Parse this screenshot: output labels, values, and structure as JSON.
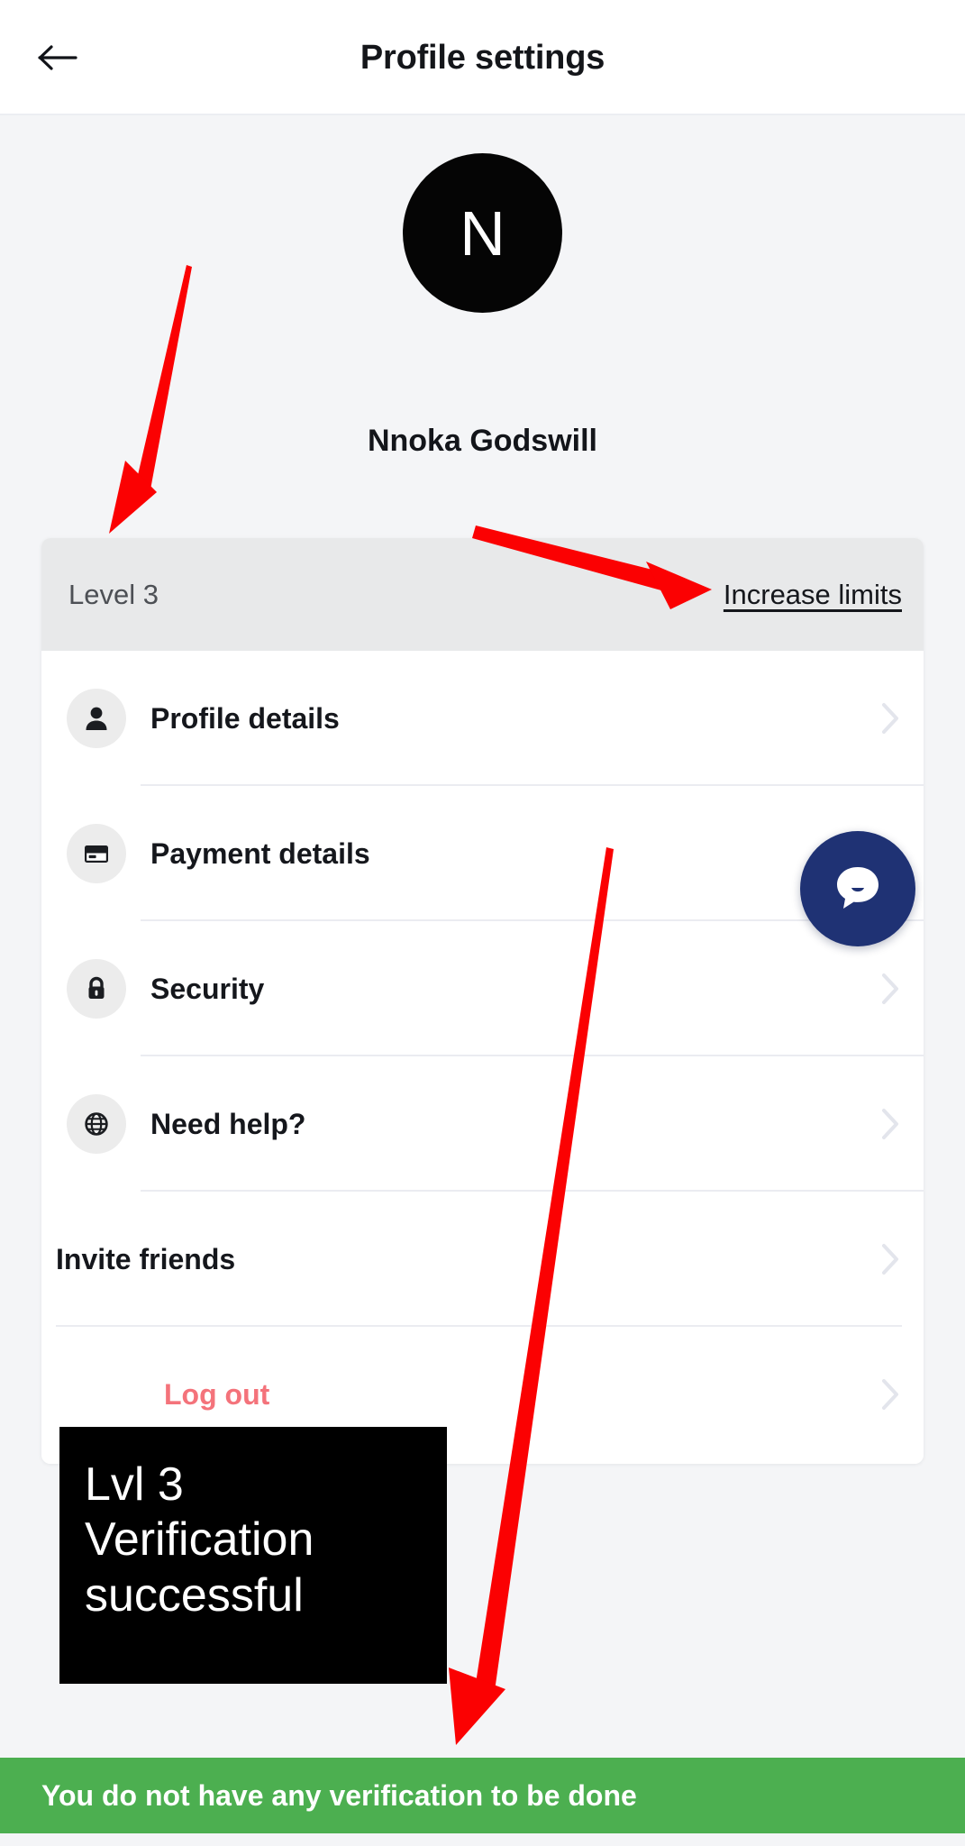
{
  "header": {
    "title": "Profile settings",
    "back_icon": "arrow-left-icon"
  },
  "profile": {
    "avatar_letter": "N",
    "name": "Nnoka Godswill"
  },
  "level_band": {
    "level_label": "Level 3",
    "increase_limits_label": "Increase limits"
  },
  "menu": {
    "items": [
      {
        "label": "Profile details",
        "icon": "person-icon",
        "has_icon": true,
        "chevron": "chevron-right-icon"
      },
      {
        "label": "Payment details",
        "icon": "credit-card-icon",
        "has_icon": true,
        "chevron": "chevron-right-icon"
      },
      {
        "label": "Security",
        "icon": "lock-icon",
        "has_icon": true,
        "chevron": "chevron-right-icon"
      },
      {
        "label": "Need help?",
        "icon": "lifebuoy-icon",
        "has_icon": true,
        "chevron": "chevron-right-icon"
      },
      {
        "label": "Invite friends",
        "icon": "",
        "has_icon": false,
        "chevron": "chevron-right-icon"
      },
      {
        "label": "Log out",
        "icon": "",
        "has_icon": false,
        "chevron": "chevron-right-icon"
      }
    ]
  },
  "chat_fab": {
    "icon": "chat-bubble-icon"
  },
  "annotation_note": {
    "text": "Lvl 3\nVerification\nsuccessful"
  },
  "toast": {
    "message": "You do not have any verification to be done"
  },
  "colors": {
    "page_background": "#f4f5f7",
    "card_background": "#ffffff",
    "level_band": "#e8e9ea",
    "avatar": "#050505",
    "logout_text": "#f4737b",
    "toast_background": "#4caf50",
    "chat_fab": "#1f3274",
    "annotation_arrow": "#fb0102",
    "divider": "#ebecf1",
    "chevron": "#e3e5ec"
  }
}
